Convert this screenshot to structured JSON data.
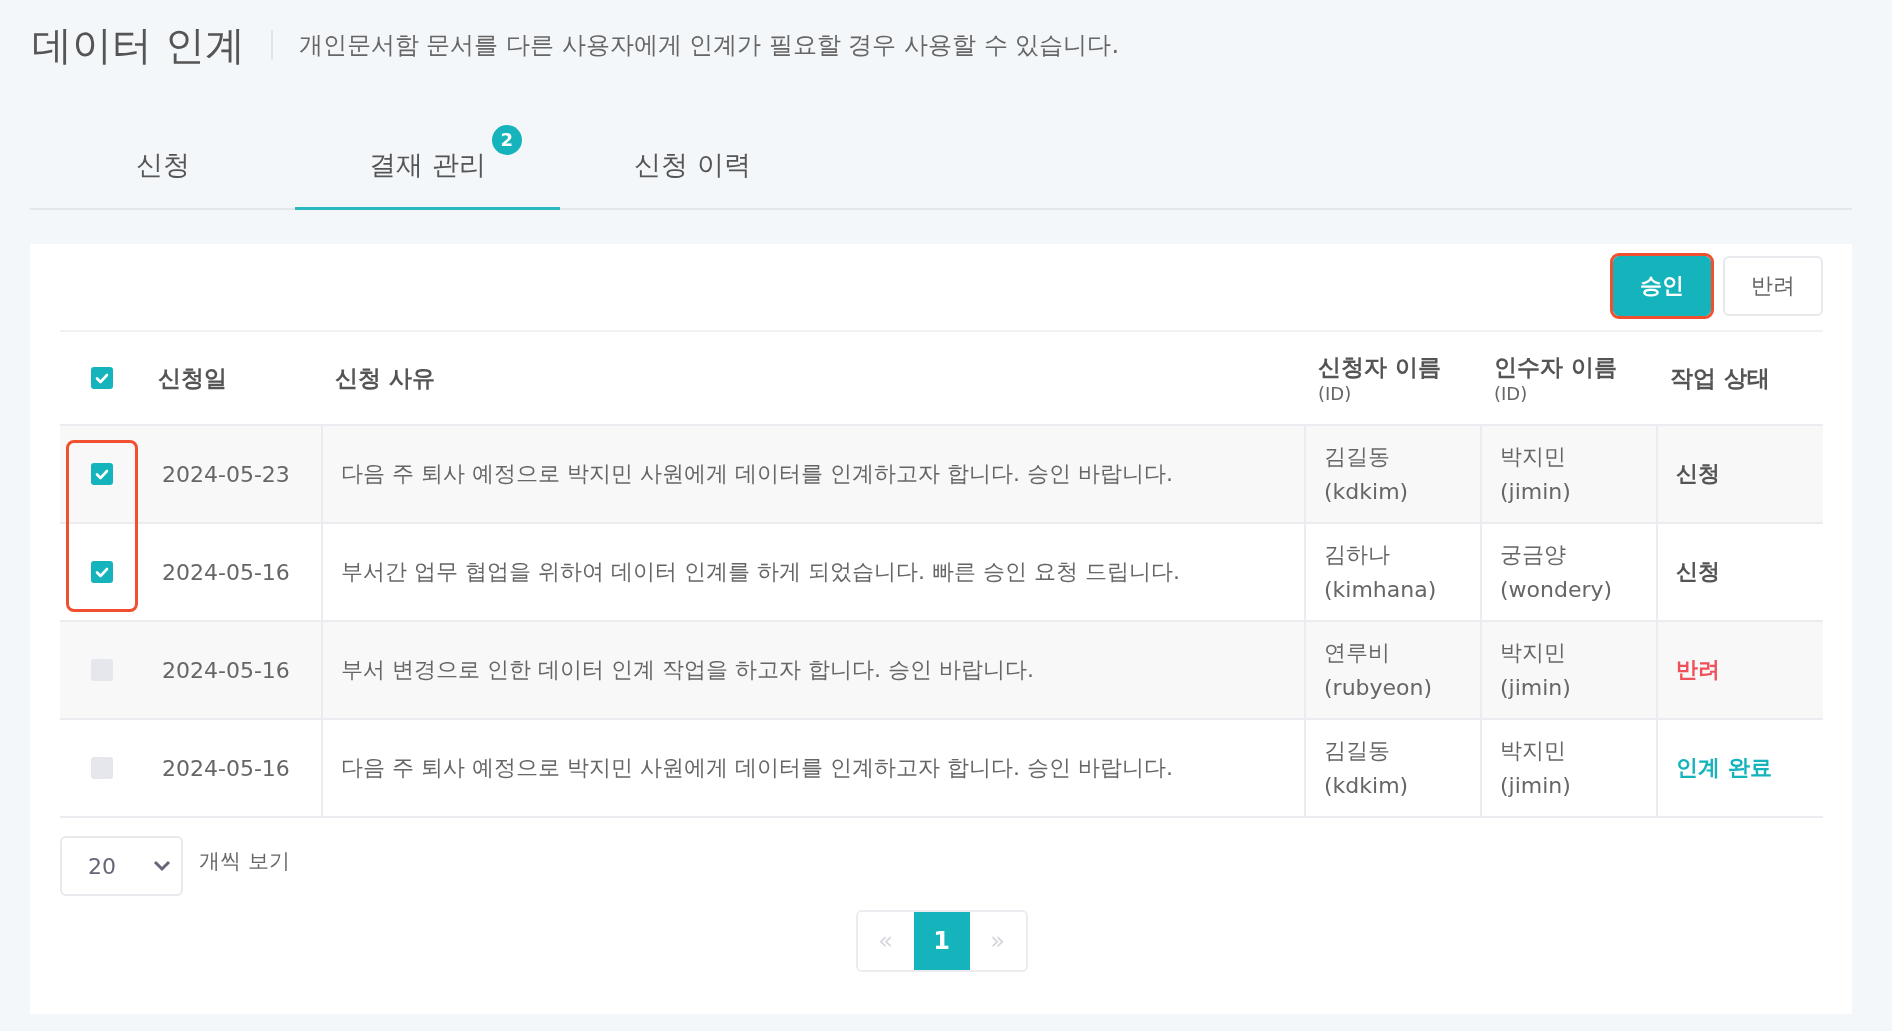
{
  "page": {
    "title": "데이터 인계",
    "description": "개인문서함 문서를 다른 사용자에게 인계가 필요할 경우 사용할 수 있습니다."
  },
  "tabs": [
    {
      "label": "신청",
      "selected": false
    },
    {
      "label": "결재 관리",
      "selected": true,
      "badge": "2"
    },
    {
      "label": "신청 이력",
      "selected": false
    }
  ],
  "actions": [
    {
      "label": "승인",
      "kind": "primary",
      "highlighted": true
    },
    {
      "label": "반려",
      "kind": "secondary",
      "highlighted": false
    }
  ],
  "table": {
    "select_all_checked": true,
    "columns": [
      {
        "label": "신청일"
      },
      {
        "label": "신청 사유"
      },
      {
        "label": "신청자 이름",
        "sub": "(ID)"
      },
      {
        "label": "인수자 이름",
        "sub": "(ID)"
      },
      {
        "label": "작업 상태"
      }
    ],
    "rows": [
      {
        "checked": true,
        "highlighted": true,
        "date": "2024-05-23",
        "reason": "다음 주 퇴사 예정으로 박지민 사원에게 데이터를 인계하고자 합니다. 승인 바랍니다.",
        "applicant_name": "김길동",
        "applicant_id": "(kdkim)",
        "receiver_name": "박지민",
        "receiver_id": "(jimin)",
        "status": {
          "label": "신청",
          "color": "#555555"
        }
      },
      {
        "checked": true,
        "highlighted": true,
        "date": "2024-05-16",
        "reason": "부서간 업무 협업을 위하여 데이터 인계를 하게 되었습니다. 빠른 승인 요청 드립니다.",
        "applicant_name": "김하나",
        "applicant_id": "(kimhana)",
        "receiver_name": "궁금양",
        "receiver_id": "(wondery)",
        "status": {
          "label": "신청",
          "color": "#555555"
        }
      },
      {
        "checked": false,
        "highlighted": false,
        "date": "2024-05-16",
        "reason": "부서 변경으로 인한 데이터 인계 작업을 하고자 합니다. 승인 바랍니다.",
        "applicant_name": "연루비",
        "applicant_id": "(rubyeon)",
        "receiver_name": "박지민",
        "receiver_id": "(jimin)",
        "status": {
          "label": "반려",
          "color": "#f0505a"
        }
      },
      {
        "checked": false,
        "highlighted": false,
        "date": "2024-05-16",
        "reason": "다음 주 퇴사 예정으로 박지민 사원에게 데이터를 인계하고자 합니다. 승인 바랍니다.",
        "applicant_name": "김길동",
        "applicant_id": "(kdkim)",
        "receiver_name": "박지민",
        "receiver_id": "(jimin)",
        "status": {
          "label": "인계 완료",
          "color": "#15b3bb"
        }
      }
    ]
  },
  "page_size": {
    "value": "20",
    "label": "개씩 보기"
  },
  "pagination": {
    "prev": {
      "label": "«",
      "disabled": true
    },
    "pages": [
      {
        "label": "1",
        "selected": true
      }
    ],
    "next": {
      "label": "»",
      "disabled": true
    }
  }
}
